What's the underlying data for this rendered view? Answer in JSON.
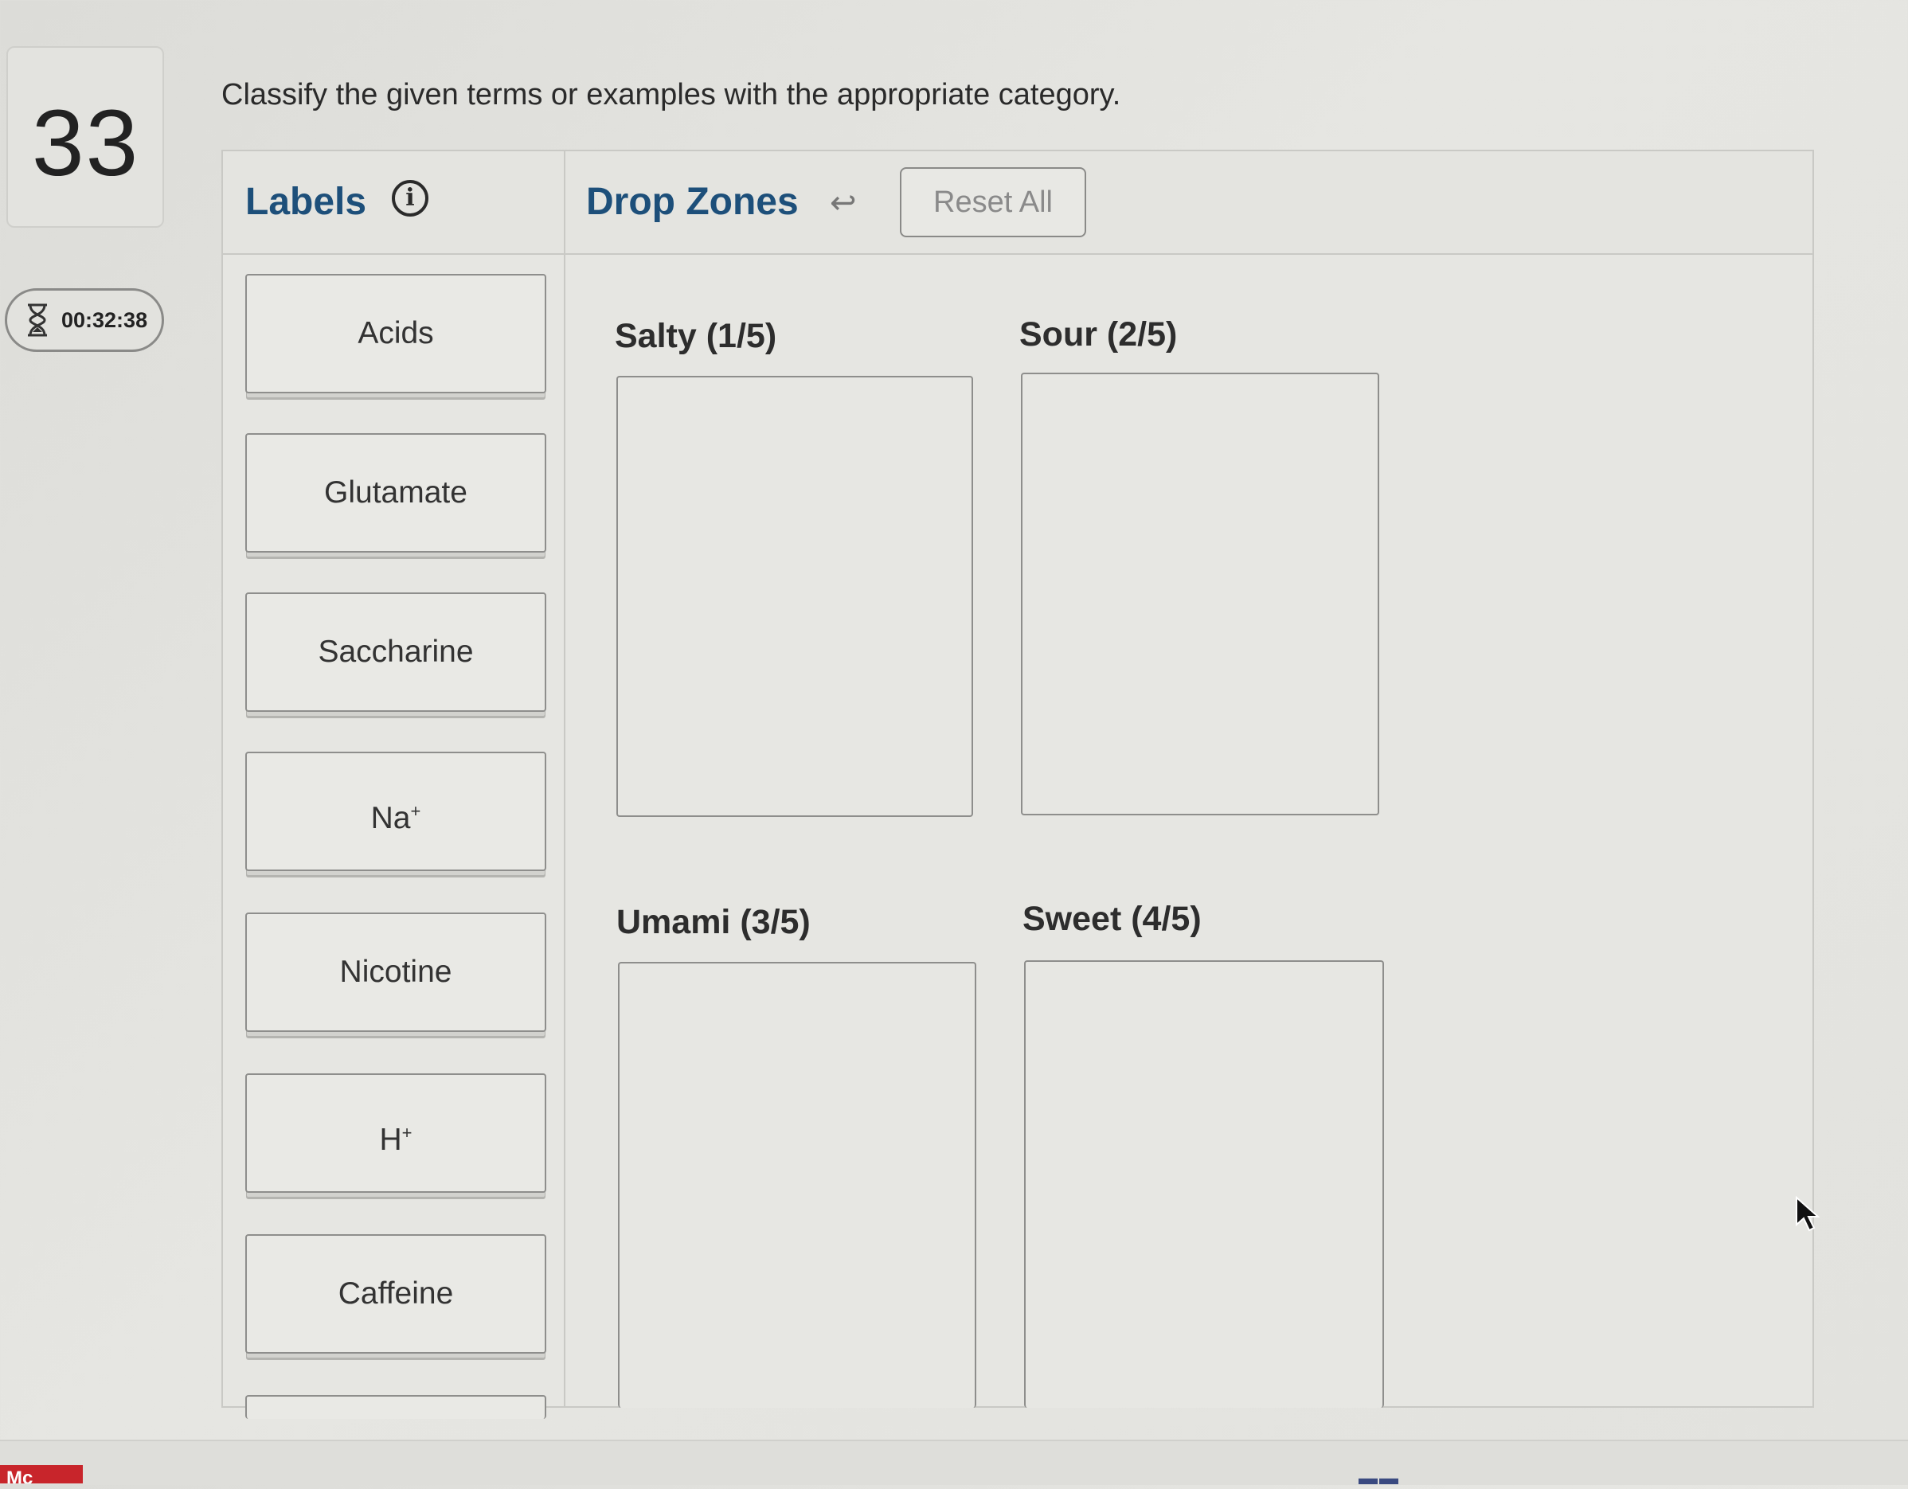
{
  "question": {
    "number": "33",
    "prompt": "Classify the given terms or examples with the appropriate category."
  },
  "timer": {
    "time": "00:32:38",
    "icon": "hourglass-icon"
  },
  "labels_panel": {
    "title": "Labels",
    "info_icon": "info-icon",
    "items": [
      {
        "text": "Acids"
      },
      {
        "text": "Glutamate"
      },
      {
        "text": "Saccharine"
      },
      {
        "text": "Na",
        "sup": "+"
      },
      {
        "text": "Nicotine"
      },
      {
        "text": "H",
        "sup": "+"
      },
      {
        "text": "Caffeine"
      }
    ]
  },
  "drop_zones_panel": {
    "title": "Drop Zones",
    "undo_icon": "undo-icon",
    "reset_label": "Reset All",
    "zones": [
      {
        "title": "Salty (1/5)"
      },
      {
        "title": "Sour (2/5)"
      },
      {
        "title": "Umami (3/5)"
      },
      {
        "title": "Sweet (4/5)"
      }
    ]
  },
  "footer": {
    "logo_text": "Mc"
  }
}
